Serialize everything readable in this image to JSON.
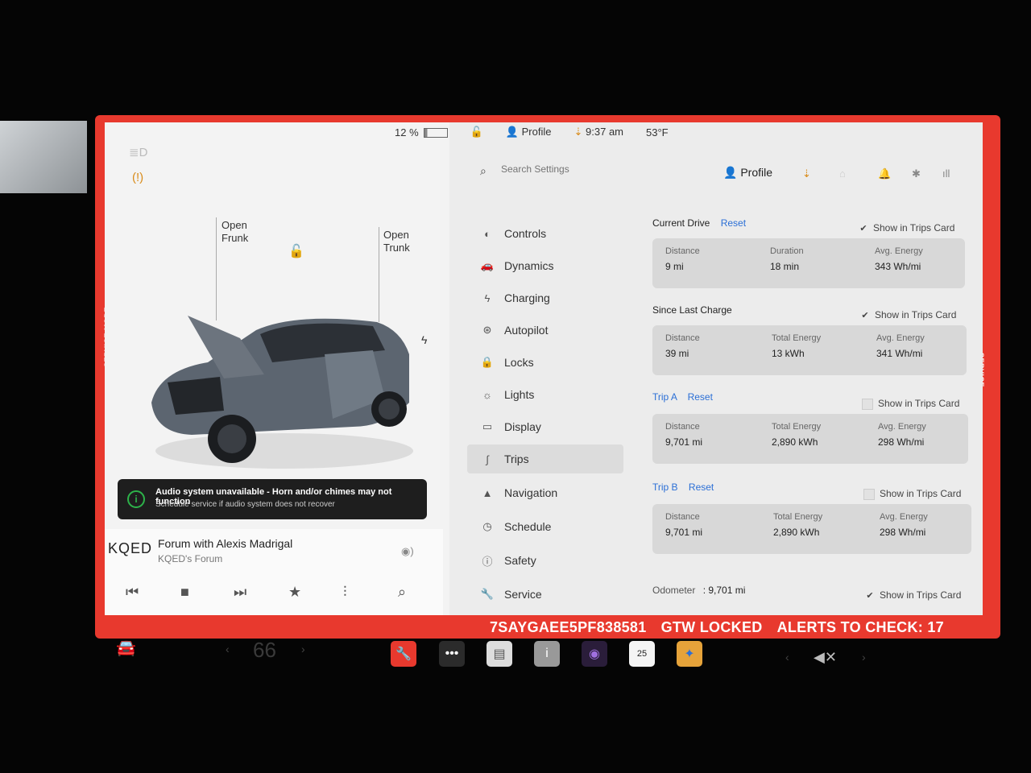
{
  "status_bar": {
    "service_mode": "SERVICE MODE",
    "battery": "12 %",
    "profile": "Profile",
    "time": "9:37 am",
    "temperature": "53°F"
  },
  "left_panel": {
    "frunk_label": [
      "Open",
      "Frunk"
    ],
    "trunk_label": [
      "Open",
      "Trunk"
    ],
    "alert": {
      "title": "Audio system unavailable - Horn and/or chimes may not function",
      "subtitle": "Schedule service if audio system does not recover"
    },
    "media": {
      "station": "KQED",
      "title": "Forum with Alexis Madrigal",
      "subtitle": "KQED's Forum"
    }
  },
  "settings": {
    "search_placeholder": "Search Settings",
    "profile": "Profile",
    "menu": [
      {
        "label": "Controls",
        "icon": "toggle-icon"
      },
      {
        "label": "Dynamics",
        "icon": "car-icon"
      },
      {
        "label": "Charging",
        "icon": "bolt-icon"
      },
      {
        "label": "Autopilot",
        "icon": "steering-wheel-icon"
      },
      {
        "label": "Locks",
        "icon": "lock-icon"
      },
      {
        "label": "Lights",
        "icon": "light-icon"
      },
      {
        "label": "Display",
        "icon": "display-icon"
      },
      {
        "label": "Trips",
        "icon": "trips-icon",
        "active": true
      },
      {
        "label": "Navigation",
        "icon": "navigation-icon"
      },
      {
        "label": "Schedule",
        "icon": "clock-icon"
      },
      {
        "label": "Safety",
        "icon": "info-icon"
      },
      {
        "label": "Service",
        "icon": "wrench-icon"
      }
    ],
    "trips": {
      "current_drive": {
        "title": "Current Drive",
        "reset": "Reset",
        "show": "Show in Trips Card",
        "checked": true,
        "cells": [
          {
            "label": "Distance",
            "value": "9 mi"
          },
          {
            "label": "Duration",
            "value": "18 min"
          },
          {
            "label": "Avg. Energy",
            "value": "343 Wh/mi"
          }
        ]
      },
      "since_last_charge": {
        "title": "Since Last Charge",
        "show": "Show in Trips Card",
        "checked": true,
        "cells": [
          {
            "label": "Distance",
            "value": "39 mi"
          },
          {
            "label": "Total Energy",
            "value": "13 kWh"
          },
          {
            "label": "Avg. Energy",
            "value": "341 Wh/mi"
          }
        ]
      },
      "trip_a": {
        "title": "Trip A",
        "reset": "Reset",
        "show": "Show in Trips Card",
        "checked": false,
        "cells": [
          {
            "label": "Distance",
            "value": "9,701 mi"
          },
          {
            "label": "Total Energy",
            "value": "2,890 kWh"
          },
          {
            "label": "Avg. Energy",
            "value": "298 Wh/mi"
          }
        ]
      },
      "trip_b": {
        "title": "Trip B",
        "reset": "Reset",
        "show": "Show in Trips Card",
        "checked": false,
        "cells": [
          {
            "label": "Distance",
            "value": "9,701 mi"
          },
          {
            "label": "Total Energy",
            "value": "2,890 kWh"
          },
          {
            "label": "Avg. Energy",
            "value": "298 Wh/mi"
          }
        ]
      },
      "odometer": {
        "label": "Odometer",
        "value": ": 9,701 mi",
        "show": "Show in Trips Card",
        "checked": true
      }
    }
  },
  "bottom_banner": {
    "vin": "7SAYGAEE5PF838581",
    "gtw": "GTW LOCKED",
    "alerts": "ALERTS TO CHECK: 17"
  },
  "taskbar": {
    "temperature": "66",
    "calendar_day": "25"
  },
  "colors": {
    "accent": "#2b6fd6",
    "service_frame": "#e8392e",
    "alert_ok": "#2db34a"
  }
}
